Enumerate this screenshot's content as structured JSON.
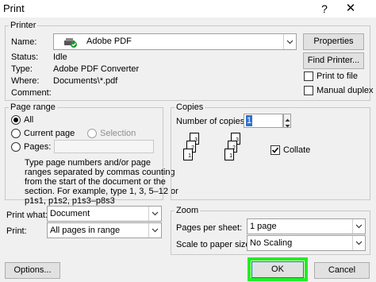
{
  "window": {
    "title": "Print",
    "help_glyph": "?",
    "close_glyph": "✕"
  },
  "printer": {
    "group_label": "Printer",
    "name_label": "Name:",
    "name_value": "Adobe PDF",
    "status_label": "Status:",
    "status_value": "Idle",
    "type_label": "Type:",
    "type_value": "Adobe PDF Converter",
    "where_label": "Where:",
    "where_value": "Documents\\*.pdf",
    "comment_label": "Comment:",
    "comment_value": "",
    "properties_label": "Properties",
    "find_printer_label": "Find Printer...",
    "print_to_file_label": "Print to file",
    "print_to_file_checked": false,
    "manual_duplex_label": "Manual duplex",
    "manual_duplex_checked": false,
    "printer_icon": "printer-icon"
  },
  "page_range": {
    "group_label": "Page range",
    "all_label": "All",
    "current_page_label": "Current page",
    "selection_label": "Selection",
    "pages_label": "Pages:",
    "pages_value": "",
    "selected": "all",
    "help_lines": [
      "Type page numbers and/or page",
      "ranges separated by commas counting",
      "from the start of the document or the",
      "section. For example, type 1, 3, 5–12 or",
      "p1s1, p1s2, p1s3–p8s3"
    ]
  },
  "copies": {
    "group_label": "Copies",
    "number_label": "Number of copies:",
    "number_value": "1",
    "collate_label": "Collate",
    "collate_checked": true,
    "collate_icon": "collate-pages-icon",
    "stack_numbers": [
      "1",
      "2",
      "3"
    ]
  },
  "print_what": {
    "label": "Print what:",
    "value": "Document"
  },
  "print_scope": {
    "label": "Print:",
    "value": "All pages in range"
  },
  "zoom": {
    "group_label": "Zoom",
    "pages_per_sheet_label": "Pages per sheet:",
    "pages_per_sheet_value": "1 page",
    "scale_label": "Scale to paper size:",
    "scale_value": "No Scaling"
  },
  "footer": {
    "options_label": "Options...",
    "ok_label": "OK",
    "cancel_label": "Cancel",
    "ok_highlight_color": "#22ee22"
  }
}
